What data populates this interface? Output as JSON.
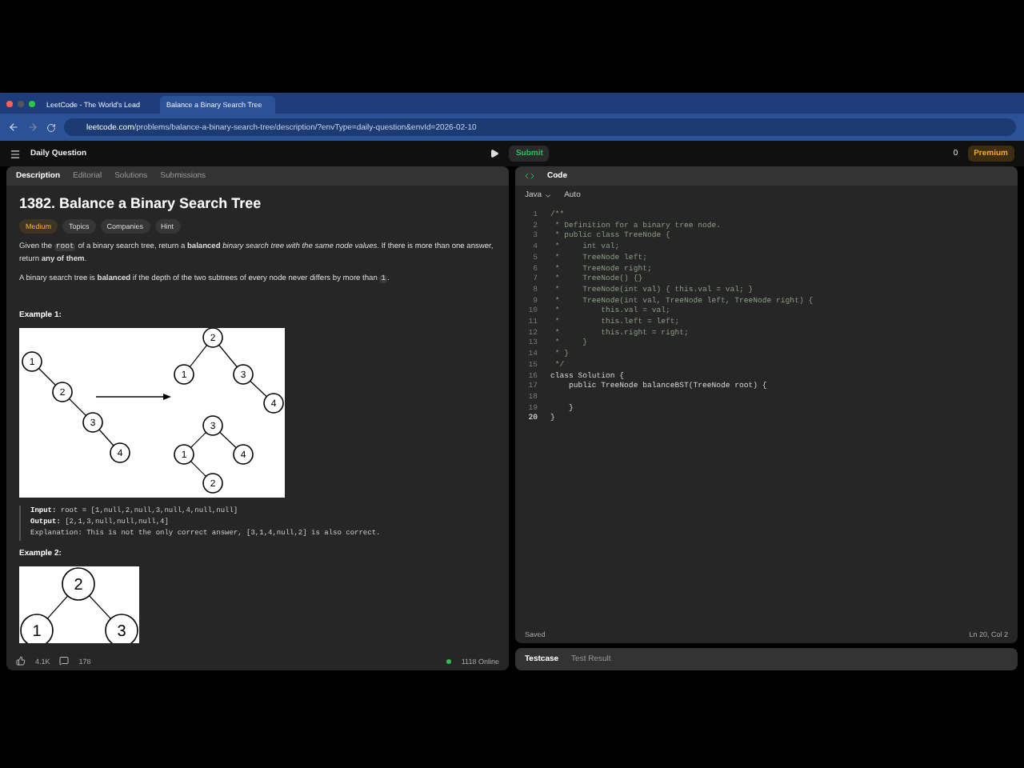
{
  "browser": {
    "tabs": [
      {
        "title": "LeetCode - The World's Lead",
        "selected": false
      },
      {
        "title": "Balance a Binary Search Tree",
        "selected": true
      }
    ],
    "url_host": "leetcode.com",
    "url_path": "/problems/balance-a-binary-search-tree/description/?envType=daily-question&envId=2026-02-10"
  },
  "app_bar": {
    "title": "Daily Question",
    "submit": "Submit",
    "notifications": "0",
    "premium": "Premium"
  },
  "problem_tabs": [
    {
      "label": "Description",
      "selected": true
    },
    {
      "label": "Editorial",
      "selected": false
    },
    {
      "label": "Solutions",
      "selected": false
    },
    {
      "label": "Submissions",
      "selected": false
    }
  ],
  "problem": {
    "title": "1382. Balance a Binary Search Tree",
    "difficulty": "Medium",
    "tags": [
      "Topics",
      "Companies",
      "Hint"
    ],
    "paragraphs": [
      [
        {
          "kind": "text",
          "text": "Given the "
        },
        {
          "kind": "code",
          "text": "root"
        },
        {
          "kind": "text",
          "text": " of a binary search tree, return a **balanced** *binary search tree with the same node values*. If there is more than one answer, return **any of them**."
        }
      ],
      [
        {
          "kind": "text",
          "text": "A binary search tree is **balanced** if the depth of the two subtrees of every node never differs by more than "
        },
        {
          "kind": "code",
          "text": "1"
        },
        {
          "kind": "text",
          "text": "."
        }
      ]
    ],
    "example1": {
      "heading": "Example 1:",
      "input_tree": [
        "1",
        "2",
        "3",
        "4"
      ],
      "output_a": [
        "2",
        "1",
        "3",
        "4"
      ],
      "output_b": [
        "3",
        "1",
        "4",
        "2"
      ],
      "lines": [
        {
          "label": "Input:",
          "text": "root = [1,null,2,null,3,null,4,null,null]"
        },
        {
          "label": "Output:",
          "text": "[2,1,3,null,null,null,4]"
        },
        {
          "text": "Explanation: This is not the only correct answer, [3,1,4,null,2] is also correct."
        }
      ]
    },
    "example2": {
      "heading": "Example 2:",
      "tree": [
        "2",
        "1",
        "3"
      ]
    }
  },
  "footer": {
    "likes": "4.1K",
    "comments": "178",
    "online": "1118 Online"
  },
  "editor": {
    "title": "Code",
    "language": "Java",
    "mode": "Auto",
    "status": "Saved",
    "cursor": "Ln 20, Col 2",
    "lines": [
      {
        "n": "1",
        "kind": "comment",
        "text": "/**"
      },
      {
        "n": "2",
        "kind": "comment",
        "text": " * Definition for a binary tree node."
      },
      {
        "n": "3",
        "kind": "comment",
        "text": " * public class TreeNode {"
      },
      {
        "n": "4",
        "kind": "comment",
        "text": " *     int val;"
      },
      {
        "n": "5",
        "kind": "comment",
        "text": " *     TreeNode left;"
      },
      {
        "n": "6",
        "kind": "comment",
        "text": " *     TreeNode right;"
      },
      {
        "n": "7",
        "kind": "comment",
        "text": " *     TreeNode() {}"
      },
      {
        "n": "8",
        "kind": "comment",
        "text": " *     TreeNode(int val) { this.val = val; }"
      },
      {
        "n": "9",
        "kind": "comment",
        "text": " *     TreeNode(int val, TreeNode left, TreeNode right) {"
      },
      {
        "n": "10",
        "kind": "comment",
        "text": " *         this.val = val;"
      },
      {
        "n": "11",
        "kind": "comment",
        "text": " *         this.left = left;"
      },
      {
        "n": "12",
        "kind": "comment",
        "text": " *         this.right = right;"
      },
      {
        "n": "13",
        "kind": "comment",
        "text": " *     }"
      },
      {
        "n": "14",
        "kind": "comment",
        "text": " * }"
      },
      {
        "n": "15",
        "kind": "comment",
        "text": " */"
      },
      {
        "n": "16",
        "kind": "code",
        "text": "class Solution {"
      },
      {
        "n": "17",
        "kind": "code",
        "text": "    public TreeNode balanceBST(TreeNode root) {"
      },
      {
        "n": "18",
        "kind": "code"
      },
      {
        "n": "19",
        "kind": "code",
        "text": "    }"
      },
      {
        "n": "20",
        "kind": "code",
        "text": "}"
      }
    ]
  },
  "bottom_tabs": [
    {
      "label": "Testcase",
      "selected": true
    },
    {
      "label": "Test Result",
      "selected": false
    }
  ]
}
